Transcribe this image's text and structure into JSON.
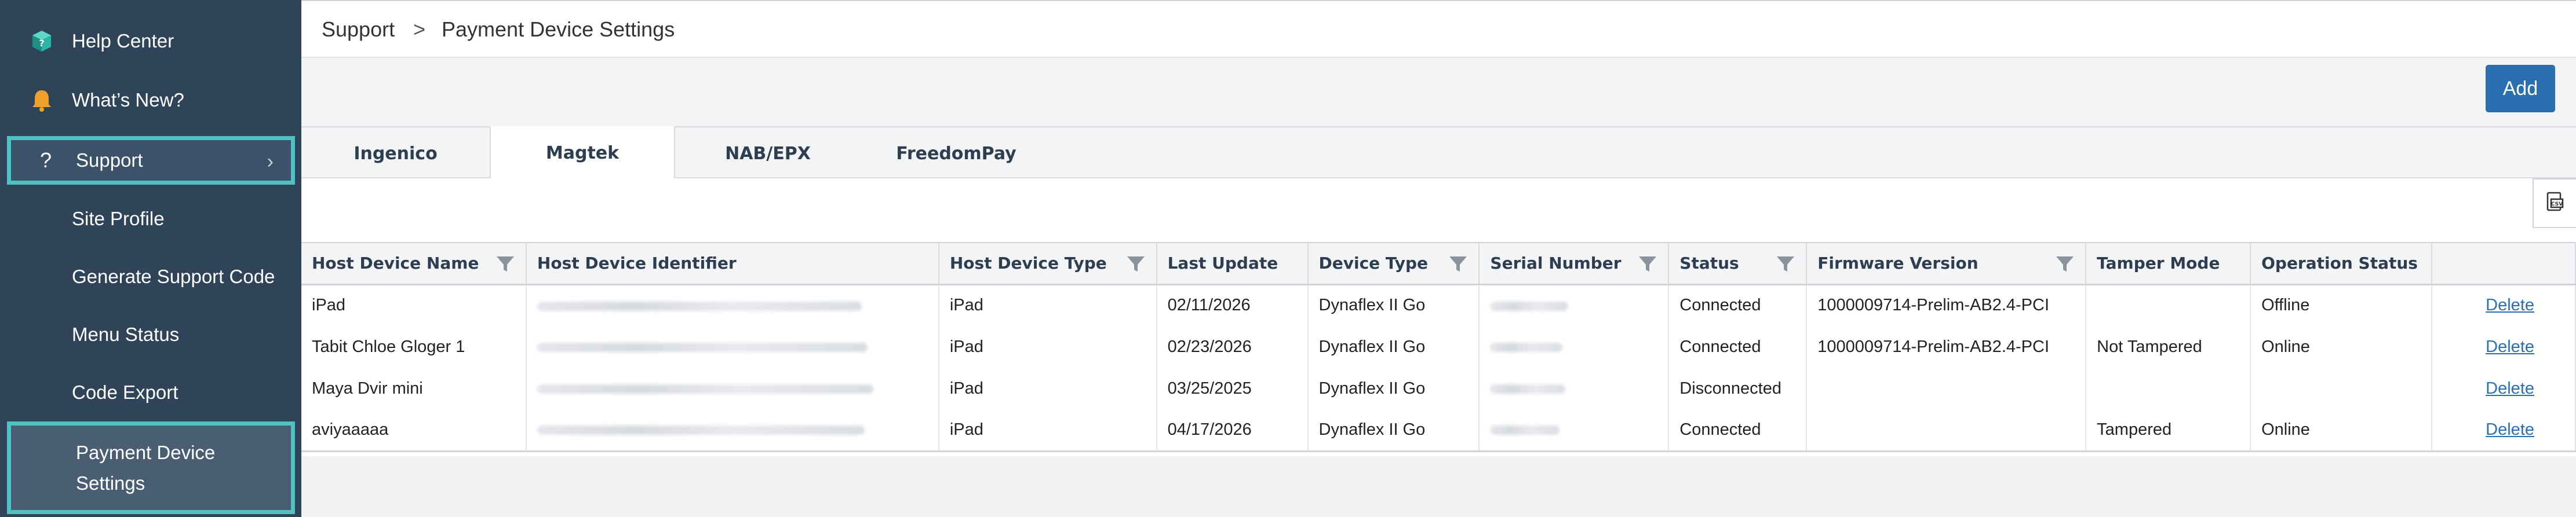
{
  "sidebar": {
    "help_center": "Help Center",
    "whats_new": "What’s New?",
    "support": "Support",
    "sub_items": [
      "Site Profile",
      "Generate Support Code",
      "Menu Status",
      "Code Export",
      "Payment Device Settings"
    ]
  },
  "breadcrumb": {
    "parent": "Support",
    "separator": ">",
    "current": "Payment Device Settings"
  },
  "toolbar": {
    "add_label": "Add"
  },
  "tabs": [
    "Ingenico",
    "Magtek",
    "NAB/EPX",
    "FreedomPay"
  ],
  "active_tab": "Magtek",
  "table": {
    "columns": [
      "Host Device Name",
      "Host Device Identifier",
      "Host Device Type",
      "Last Update",
      "Device Type",
      "Serial Number",
      "Status",
      "Firmware Version",
      "Tamper Mode",
      "Operation Status"
    ],
    "rows": [
      {
        "name": "iPad",
        "type": "iPad",
        "updated": "02/11/2026",
        "device": "Dynaflex II Go",
        "status": "Connected",
        "firmware": "1000009714-Prelim-AB2.4-PCI",
        "tamper": "",
        "operation": "Offline",
        "action": "Delete"
      },
      {
        "name": "Tabit Chloe Gloger 1",
        "type": "iPad",
        "updated": "02/23/2026",
        "device": "Dynaflex II Go",
        "status": "Connected",
        "firmware": "1000009714-Prelim-AB2.4-PCI",
        "tamper": "Not Tampered",
        "operation": "Online",
        "action": "Delete"
      },
      {
        "name": "Maya Dvir mini",
        "type": "iPad",
        "updated": "03/25/2025",
        "device": "Dynaflex II Go",
        "status": "Disconnected",
        "firmware": "",
        "tamper": "",
        "operation": "",
        "action": "Delete"
      },
      {
        "name": "aviyaaaaa",
        "type": "iPad",
        "updated": "04/17/2026",
        "device": "Dynaflex II Go",
        "status": "Connected",
        "firmware": "",
        "tamper": "Tampered",
        "operation": "Online",
        "action": "Delete"
      }
    ]
  },
  "icons": {
    "help": "help-center-icon",
    "news": "bell-icon",
    "support": "question-icon",
    "filter": "filter-icon",
    "export": "export-icon"
  },
  "colors": {
    "sidebar_bg": "#2f4458",
    "highlight": "#4fc3c3",
    "accent": "#2a6fb0"
  }
}
